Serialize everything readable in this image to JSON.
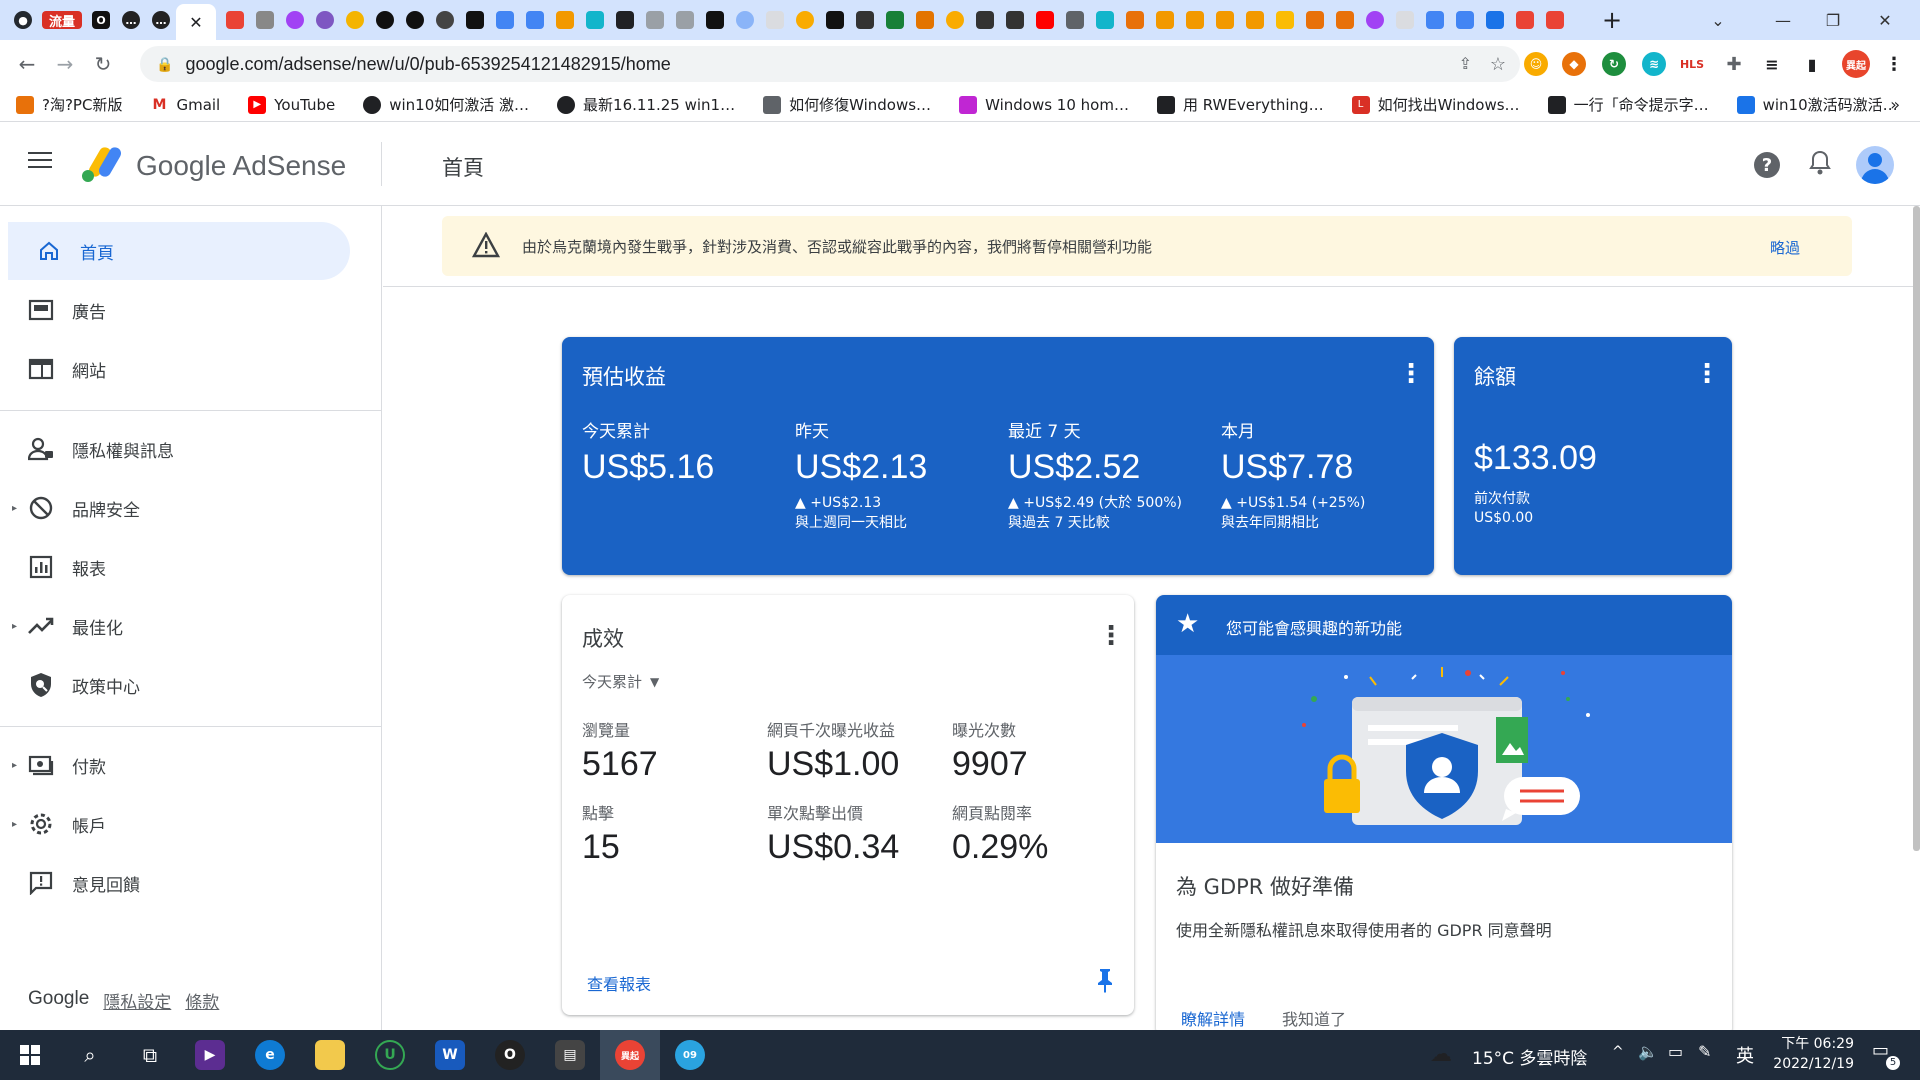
{
  "browser": {
    "tabs": [
      {
        "icon": "github-icon",
        "label": ""
      },
      {
        "icon": "traffic-tab-icon",
        "label": "流量"
      },
      {
        "icon": "tab-icon-o",
        "label": "O"
      },
      {
        "icon": "tab-icon-dots",
        "label": "…"
      },
      {
        "icon": "tab-icon-dots2",
        "label": "…"
      },
      {
        "icon": "close-icon",
        "label": "✕"
      }
    ],
    "new_tab": "+",
    "url": "google.com/adsense/new/u/0/pub-6539254121482915/home",
    "profile_badge": "異起",
    "bookmarks": [
      {
        "label": "?淘?PC新版",
        "color": "#e8710a"
      },
      {
        "label": "Gmail",
        "color": "#d93025"
      },
      {
        "label": "YouTube",
        "color": "#ff0000"
      },
      {
        "label": "win10如何激活 激…",
        "color": "#202124"
      },
      {
        "label": "最新16.11.25 win1…",
        "color": "#202124"
      },
      {
        "label": "如何修復Windows…",
        "color": "#5f6368"
      },
      {
        "label": "Windows 10 hom…",
        "color": "#c026d3"
      },
      {
        "label": "用 RWEverything…",
        "color": "#202124"
      },
      {
        "label": "如何找出Windows…",
        "color": "#d93025"
      },
      {
        "label": "一行「命令提示字…",
        "color": "#202124"
      },
      {
        "label": "win10激活码激活…",
        "color": "#1a73e8"
      }
    ],
    "bookmarks_more": "»"
  },
  "app": {
    "product": "Google AdSense",
    "page_title": "首頁",
    "banner": {
      "text": "由於烏克蘭境內發生戰爭，針對涉及消費、否認或縱容此戰爭的內容，我們將暫停相關營利功能",
      "dismiss": "略過"
    },
    "nav": [
      {
        "label": "首頁",
        "icon": "home-icon"
      },
      {
        "label": "廣告",
        "icon": "ads-icon"
      },
      {
        "label": "網站",
        "icon": "sites-icon"
      },
      {
        "label": "隱私權與訊息",
        "icon": "privacy-icon"
      },
      {
        "label": "品牌安全",
        "icon": "block-icon"
      },
      {
        "label": "報表",
        "icon": "reports-icon"
      },
      {
        "label": "最佳化",
        "icon": "optimize-icon"
      },
      {
        "label": "政策中心",
        "icon": "policy-icon"
      },
      {
        "label": "付款",
        "icon": "payments-icon"
      },
      {
        "label": "帳戶",
        "icon": "settings-icon"
      },
      {
        "label": "意見回饋",
        "icon": "feedback-icon"
      }
    ],
    "footer": {
      "google": "Google",
      "privacy": "隱私設定",
      "terms": "條款"
    }
  },
  "earnings": {
    "title": "預估收益",
    "metrics": [
      {
        "label": "今天累計",
        "value": "US$5.16",
        "delta": "",
        "compare": ""
      },
      {
        "label": "昨天",
        "value": "US$2.13",
        "delta": "▲ +US$2.13",
        "compare": "與上週同一天相比"
      },
      {
        "label": "最近 7 天",
        "value": "US$2.52",
        "delta": "▲ +US$2.49 (大於 500%)",
        "compare": "與過去 7 天比較"
      },
      {
        "label": "本月",
        "value": "US$7.78",
        "delta": "▲ +US$1.54 (+25%)",
        "compare": "與去年同期相比"
      }
    ]
  },
  "balance": {
    "title": "餘額",
    "amount": "$133.09",
    "last_payment_label": "前次付款",
    "last_payment_value": "US$0.00"
  },
  "performance": {
    "title": "成效",
    "range": "今天累計",
    "stats": [
      {
        "label": "瀏覽量",
        "value": "5167"
      },
      {
        "label": "網頁千次曝光收益",
        "value": "US$1.00"
      },
      {
        "label": "曝光次數",
        "value": "9907"
      },
      {
        "label": "點擊",
        "value": "15"
      },
      {
        "label": "單次點擊出價",
        "value": "US$0.34"
      },
      {
        "label": "網頁點閱率",
        "value": "0.29%"
      }
    ],
    "link": "查看報表"
  },
  "feature": {
    "header": "您可能會感興趣的新功能",
    "title": "為 GDPR 做好準備",
    "desc": "使用全新隱私權訊息來取得使用者的 GDPR 同意聲明",
    "learn_more": "瞭解詳情",
    "got_it": "我知道了"
  },
  "taskbar": {
    "weather": "15°C 多雲時陰",
    "ime": "英",
    "time": "下午 06:29",
    "date": "2022/12/19",
    "notifications": "5",
    "chrome_badge": "異起",
    "telegram_badge": "09"
  },
  "colors": {
    "brand_blue": "#1a62c4",
    "accent": "#1967d2",
    "banner_bg": "#fef7e0"
  }
}
